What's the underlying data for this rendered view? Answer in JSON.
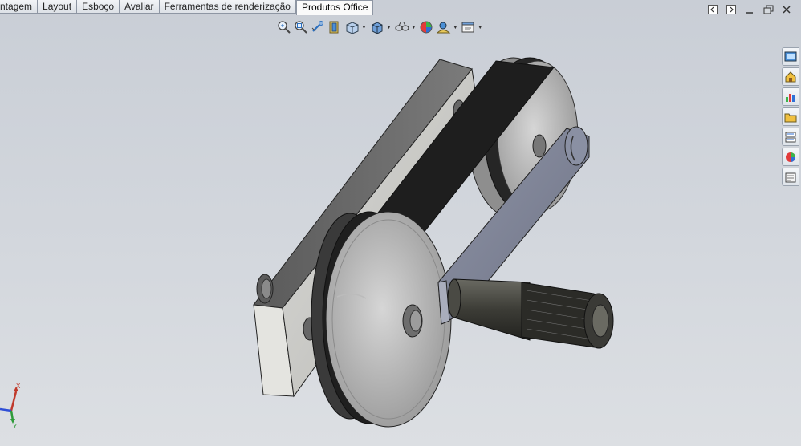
{
  "ribbon": {
    "tabs": [
      {
        "label": "ntagem"
      },
      {
        "label": "Layout"
      },
      {
        "label": "Esboço"
      },
      {
        "label": "Avaliar"
      },
      {
        "label": "Ferramentas de renderização"
      },
      {
        "label": "Produtos Office"
      }
    ],
    "active_tab": "Produtos Office"
  },
  "heads_up_toolbar": {
    "tools": [
      "zoom-to-fit-icon",
      "zoom-to-area-icon",
      "previous-view-icon",
      "section-view-icon",
      "view-orientation-icon",
      "display-style-icon",
      "hide-show-items-icon",
      "edit-appearance-icon",
      "apply-scene-icon",
      "view-settings-icon"
    ]
  },
  "task_pane": {
    "tools": [
      "solidworks-resources-icon",
      "design-library-icon",
      "file-explorer-icon",
      "view-palette-icon",
      "appearances-icon",
      "custom-properties-icon",
      "forum-icon"
    ]
  },
  "triad": {
    "x_label": "X",
    "y_label": "Y"
  },
  "colors": {
    "viewport_top": "#c9ced6",
    "viewport_bottom": "#dcdfe3",
    "belt": "#1e1e1e",
    "pulley": "#c4c4c4"
  }
}
